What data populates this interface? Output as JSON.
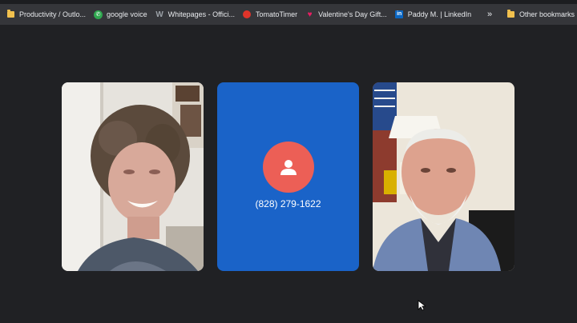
{
  "bookmarks": [
    {
      "label": "Productivity / Outlo...",
      "icon": "folder-icon"
    },
    {
      "label": "google voice",
      "icon": "phone-icon"
    },
    {
      "label": "Whitepages - Offici...",
      "icon": "whitepages-icon"
    },
    {
      "label": "TomatoTimer",
      "icon": "tomato-icon"
    },
    {
      "label": "Valentine's Day Gift...",
      "icon": "heart-icon"
    },
    {
      "label": "Paddy M. | LinkedIn",
      "icon": "linkedin-icon"
    }
  ],
  "overflow_label": "»",
  "other_bookmarks_label": "Other bookmarks",
  "call": {
    "phone_number": "(828) 279-1622",
    "avatar_color": "#ec5f56",
    "tile_color": "#1a63c8"
  },
  "participants": [
    {
      "name": "participant-video-left"
    },
    {
      "name": "participant-video-right"
    }
  ]
}
